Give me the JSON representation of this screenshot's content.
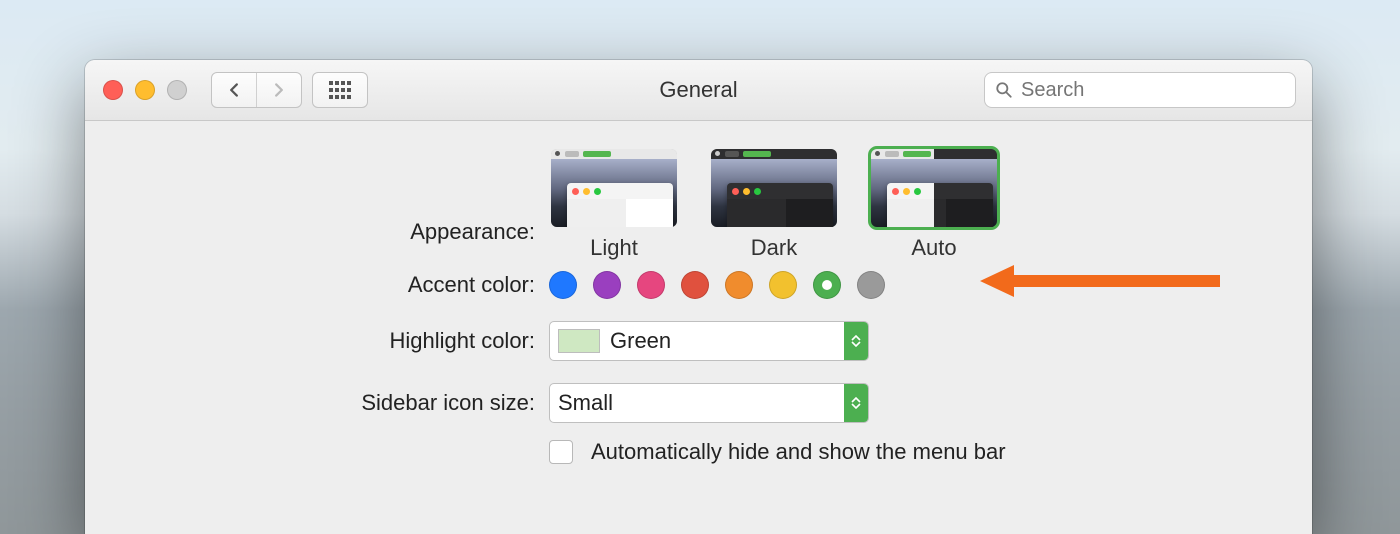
{
  "window": {
    "title": "General"
  },
  "search": {
    "placeholder": "Search"
  },
  "appearance": {
    "label": "Appearance:",
    "options": {
      "light": "Light",
      "dark": "Dark",
      "auto": "Auto"
    },
    "selected": "Auto"
  },
  "accent": {
    "label": "Accent color:",
    "colors": {
      "blue": "#1f78ff",
      "purple": "#9a3fbf",
      "pink": "#e6467f",
      "red": "#e0513e",
      "orange": "#f08c2d",
      "yellow": "#f2c12e",
      "green": "#4caf50",
      "graphite": "#9a9a9a"
    },
    "selected": "green"
  },
  "highlight": {
    "label": "Highlight color:",
    "value": "Green",
    "swatch": "#cfe8c2"
  },
  "sidebar_icon": {
    "label": "Sidebar icon size:",
    "value": "Small"
  },
  "menubar_hide": {
    "label": "Automatically hide and show the menu bar",
    "checked": false
  }
}
